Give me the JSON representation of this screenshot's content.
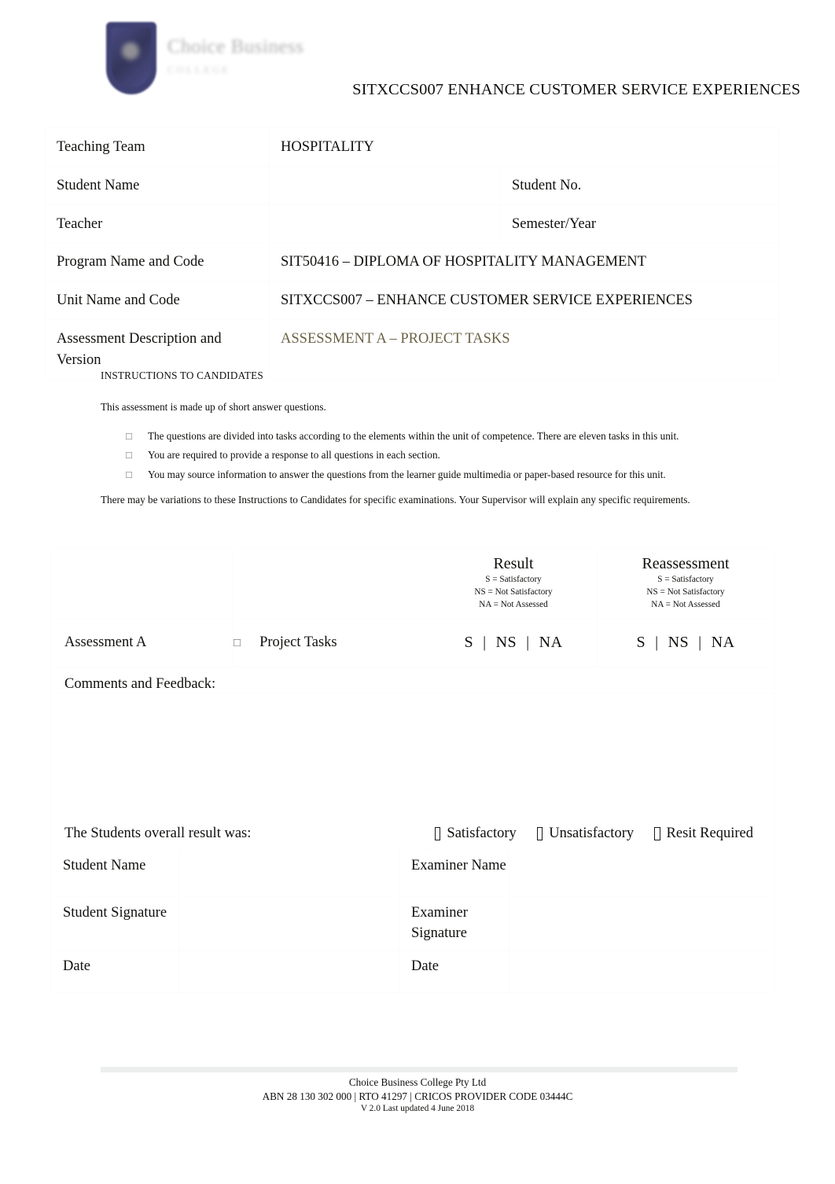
{
  "header": {
    "logo": {
      "crest_icon": "shield-crest-icon",
      "name_line1": "Choice Business",
      "name_line2": "COLLEGE"
    },
    "title": "SITXCCS007 ENHANCE CUSTOMER SERVICE EXPERIENCES"
  },
  "info_table": {
    "rows": [
      {
        "label": "Teaching Team",
        "value": "HOSPITALITY"
      },
      {
        "label": "Student Name",
        "value": "",
        "label2": "Student No.",
        "value2": ""
      },
      {
        "label": "Teacher",
        "value": "",
        "label2": "Semester/Year",
        "value2": ""
      },
      {
        "label": "Program Name and Code",
        "value": "SIT50416 – DIPLOMA OF HOSPITALITY MANAGEMENT"
      },
      {
        "label": "Unit Name and Code",
        "value": "SITXCCS007 – ENHANCE CUSTOMER SERVICE EXPERIENCES"
      },
      {
        "label": "Assessment Description and Version",
        "value": "ASSESSMENT A – PROJECT TASKS"
      }
    ],
    "accent_color": "#6b6245"
  },
  "instructions": {
    "heading": "INSTRUCTIONS TO CANDIDATES",
    "lead": "This assessment is made up of short answer questions.",
    "bullet_marker": "□",
    "bullets": [
      "The questions are divided into tasks according to the elements within the unit of competence. There are eleven tasks in this unit.",
      "You are required to provide a response to all questions in each section.",
      "You may source information to answer the questions from the learner guide multimedia or paper-based resource for this unit."
    ],
    "tail": "There may be variations to these Instructions to Candidates for specific examinations. Your Supervisor will explain any specific requirements."
  },
  "result_table": {
    "result_header": {
      "title": "Result",
      "key_lines": [
        "S = Satisfactory",
        "NS = Not Satisfactory",
        "NA = Not Assessed"
      ]
    },
    "reassessment_header": {
      "title": "Reassessment",
      "key_lines": [
        "S = Satisfactory",
        "NS = Not Satisfactory",
        "NA = Not Assessed"
      ]
    },
    "assessment_row": {
      "name": "Assessment A",
      "task_marker": "□",
      "task": "Project Tasks",
      "grades": [
        "S",
        "NS",
        "NA"
      ],
      "separator": "|"
    },
    "comments_label": "Comments and Feedback:",
    "overall": {
      "label": "The Students overall result was:",
      "options": [
        "Satisfactory",
        "Unsatisfactory",
        "Resit Required"
      ]
    }
  },
  "signature_table": {
    "rows": [
      {
        "left_label": "Student Name",
        "left_value": "",
        "right_label": "Examiner Name",
        "right_value": ""
      },
      {
        "left_label": "Student Signature",
        "left_value": "",
        "right_label": "Examiner Signature",
        "right_value": ""
      },
      {
        "left_label": "Date",
        "left_value": "",
        "right_label": "Date",
        "right_value": ""
      }
    ]
  },
  "footer": {
    "line1": "Choice Business College Pty Ltd",
    "line2": "ABN 28 130 302 000 | RTO 41297 | CRICOS PROVIDER CODE 03444C",
    "line3": "V 2.0 Last updated 4 June 2018"
  }
}
